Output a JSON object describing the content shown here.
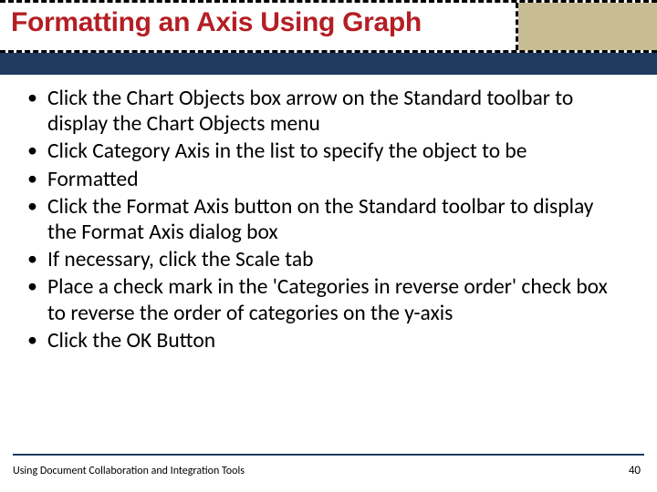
{
  "title": "Formatting an Axis Using Graph",
  "bullets": [
    "Click the Chart Objects box arrow on the Standard toolbar to display the Chart Objects menu",
    "Click Category Axis in the list to specify the object to be",
    "Formatted",
    "Click the Format Axis button on the Standard toolbar to display the Format Axis dialog box",
    "If necessary, click the Scale tab",
    "Place a check mark in the 'Categories in reverse order' check box to reverse the order of categories on the y-axis",
    "Click the OK Button"
  ],
  "footer": "Using Document Collaboration and Integration Tools",
  "page_number": "40"
}
